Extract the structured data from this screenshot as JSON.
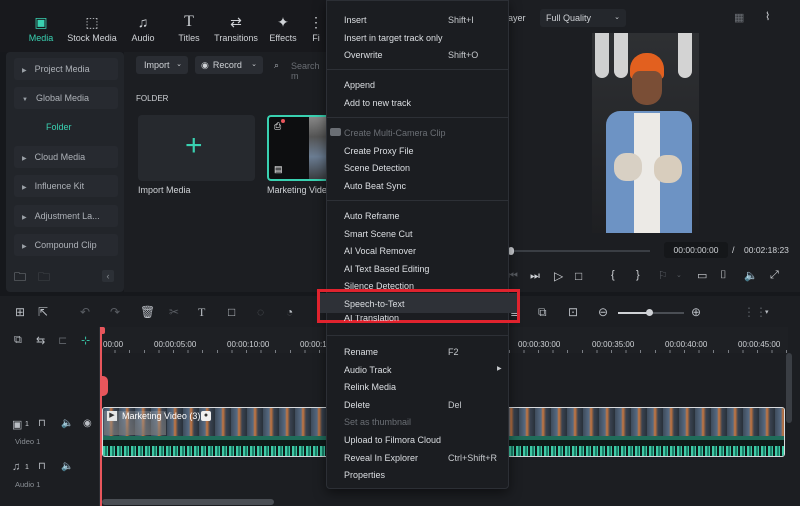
{
  "toolbar": {
    "tabs": [
      {
        "label": "Media",
        "icon": "media-icon",
        "active": true
      },
      {
        "label": "Stock Media",
        "icon": "stock-media-icon"
      },
      {
        "label": "Audio",
        "icon": "music-note-icon"
      },
      {
        "label": "Titles",
        "icon": "text-t-icon"
      },
      {
        "label": "Transitions",
        "icon": "transitions-icon"
      },
      {
        "label": "Effects",
        "icon": "effects-sparkle-icon"
      },
      {
        "label": "Fi",
        "icon": "filters-icon"
      }
    ]
  },
  "sidebar": {
    "items": [
      {
        "label": "Project Media"
      },
      {
        "label": "Global Media",
        "expanded": true
      },
      {
        "label": "Cloud Media"
      },
      {
        "label": "Influence Kit"
      },
      {
        "label": "Adjustment La..."
      },
      {
        "label": "Compound Clip"
      }
    ],
    "folder_label": "Folder"
  },
  "media": {
    "import_label": "Import",
    "record_label": "Record",
    "search_placeholder": "Search m",
    "section_title": "FOLDER",
    "items": [
      {
        "label": "Import Media"
      },
      {
        "label": "Marketing Vide"
      }
    ]
  },
  "player": {
    "player_label": "ayer",
    "quality": "Full Quality",
    "current_time": "00:00:00:00",
    "separator": "/",
    "total_time": "00:02:18:23"
  },
  "context_menu": {
    "items": [
      {
        "label": "Insert",
        "shortcut": "Shift+I"
      },
      {
        "label": "Insert in target track only"
      },
      {
        "label": "Overwrite",
        "shortcut": "Shift+O"
      },
      {
        "label": "Append"
      },
      {
        "label": "Add to new track"
      },
      {
        "label": "Create Multi-Camera Clip",
        "disabled": true
      },
      {
        "label": "Create Proxy File"
      },
      {
        "label": "Scene Detection"
      },
      {
        "label": "Auto Beat Sync"
      },
      {
        "label": "Auto Reframe"
      },
      {
        "label": "Smart Scene Cut"
      },
      {
        "label": "AI Vocal Remover"
      },
      {
        "label": "AI Text Based Editing"
      },
      {
        "label": "Silence Detection"
      },
      {
        "label": "Speech-to-Text",
        "highlighted": true
      },
      {
        "label": "AI Translation"
      },
      {
        "label": "Rename",
        "shortcut": "F2"
      },
      {
        "label": "Audio Track",
        "submenu": true
      },
      {
        "label": "Relink Media"
      },
      {
        "label": "Delete",
        "shortcut": "Del"
      },
      {
        "label": "Set as thumbnail",
        "disabled": true
      },
      {
        "label": "Upload to Filmora Cloud"
      },
      {
        "label": "Reveal In Explorer",
        "shortcut": "Ctrl+Shift+R"
      },
      {
        "label": "Properties"
      }
    ],
    "highlight_color": "#e0232e"
  },
  "timeline": {
    "ruler": [
      "00:00",
      "00:00:05:00",
      "00:00:10:00",
      "00:00:1",
      "00:00:30:00",
      "00:00:35:00",
      "00:00:40:00",
      "00:00:45:00"
    ],
    "tracks": [
      {
        "name": "Video 1",
        "index": "1"
      },
      {
        "name": "Audio 1",
        "index": "1"
      }
    ],
    "clip_label": "Marketing Video (3)",
    "zoom_level": 0.6
  },
  "colors": {
    "accent": "#39d1b1",
    "playhead": "#e8565c",
    "highlight_box": "#e0232e"
  }
}
